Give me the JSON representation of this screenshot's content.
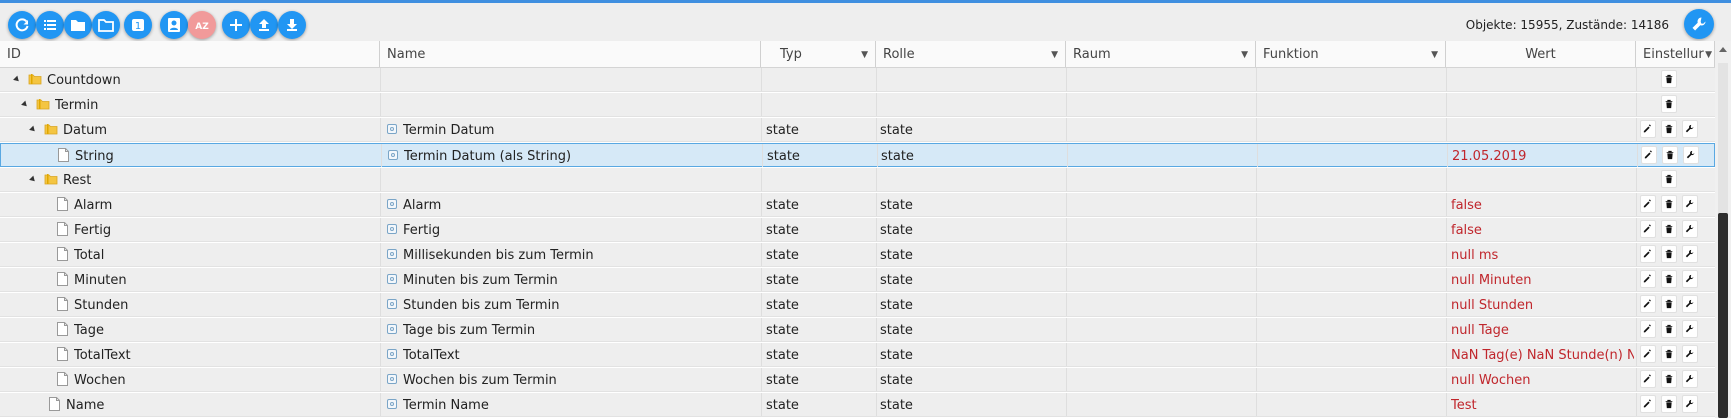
{
  "toolbar": {
    "buttons": [
      {
        "name": "refresh-button",
        "icon": "refresh-icon"
      },
      {
        "name": "list-view-button",
        "icon": "list-icon"
      },
      {
        "name": "expand-folders-button",
        "icon": "folder-icon"
      },
      {
        "name": "collapse-folders-button",
        "icon": "folder-open-icon"
      },
      {
        "name": "level-button",
        "icon": "number-one-icon",
        "label": "1"
      },
      {
        "name": "edit-roles-button",
        "icon": "contact-icon"
      },
      {
        "name": "sort-az-button",
        "icon": "sort-az-icon",
        "label": "AZ"
      },
      {
        "name": "add-button",
        "icon": "plus-icon"
      },
      {
        "name": "upload-button",
        "icon": "upload-icon"
      },
      {
        "name": "download-button",
        "icon": "download-icon"
      }
    ],
    "stats": "Objekte: 15955, Zustände: 14186",
    "settings_icon": "wrench-icon"
  },
  "columns": {
    "id": "ID",
    "name": "Name",
    "type": "Typ",
    "role": "Rolle",
    "room": "Raum",
    "function": "Funktion",
    "value": "Wert",
    "settings": "Einstellur"
  },
  "rows": [
    {
      "id": "Countdown",
      "level": 1,
      "kind": "folder",
      "name": "",
      "type": "",
      "role": "",
      "value": "",
      "actions": [
        "delete"
      ]
    },
    {
      "id": "Termin",
      "level": 2,
      "kind": "folder",
      "name": "",
      "type": "",
      "role": "",
      "value": "",
      "actions": [
        "delete"
      ]
    },
    {
      "id": "Datum",
      "level": 3,
      "kind": "folder",
      "name": "Termin Datum",
      "type": "state",
      "role": "state",
      "value": "",
      "actions": [
        "edit",
        "delete",
        "settings"
      ]
    },
    {
      "id": "String",
      "level": 4,
      "kind": "file",
      "name": "Termin Datum (als String)",
      "type": "state",
      "role": "state",
      "value": "21.05.2019",
      "selected": true,
      "actions": [
        "edit",
        "delete",
        "settings"
      ]
    },
    {
      "id": "Rest",
      "level": 3,
      "kind": "folder",
      "name": "",
      "type": "",
      "role": "",
      "value": "",
      "actions": [
        "delete"
      ]
    },
    {
      "id": "Alarm",
      "level": 4,
      "kind": "file",
      "name": "Alarm",
      "type": "state",
      "role": "state",
      "value": "false",
      "actions": [
        "edit",
        "delete",
        "settings"
      ]
    },
    {
      "id": "Fertig",
      "level": 4,
      "kind": "file",
      "name": "Fertig",
      "type": "state",
      "role": "state",
      "value": "false",
      "actions": [
        "edit",
        "delete",
        "settings"
      ]
    },
    {
      "id": "Total",
      "level": 4,
      "kind": "file",
      "name": "Millisekunden bis zum Termin",
      "type": "state",
      "role": "state",
      "value": "null ms",
      "actions": [
        "edit",
        "delete",
        "settings"
      ]
    },
    {
      "id": "Minuten",
      "level": 4,
      "kind": "file",
      "name": "Minuten bis zum Termin",
      "type": "state",
      "role": "state",
      "value": "null Minuten",
      "actions": [
        "edit",
        "delete",
        "settings"
      ]
    },
    {
      "id": "Stunden",
      "level": 4,
      "kind": "file",
      "name": "Stunden bis zum Termin",
      "type": "state",
      "role": "state",
      "value": "null Stunden",
      "actions": [
        "edit",
        "delete",
        "settings"
      ]
    },
    {
      "id": "Tage",
      "level": 4,
      "kind": "file",
      "name": "Tage bis zum Termin",
      "type": "state",
      "role": "state",
      "value": "null Tage",
      "actions": [
        "edit",
        "delete",
        "settings"
      ]
    },
    {
      "id": "TotalText",
      "level": 4,
      "kind": "file",
      "name": "TotalText",
      "type": "state",
      "role": "state",
      "value": "NaN Tag(e) NaN Stunde(n) NaN",
      "actions": [
        "edit",
        "delete",
        "settings"
      ]
    },
    {
      "id": "Wochen",
      "level": 4,
      "kind": "file",
      "name": "Wochen bis zum Termin",
      "type": "state",
      "role": "state",
      "value": "null Wochen",
      "actions": [
        "edit",
        "delete",
        "settings"
      ]
    },
    {
      "id": "Name",
      "level": 3,
      "kind": "file",
      "name": "Termin Name",
      "type": "state",
      "role": "state",
      "value": "Test",
      "actions": [
        "edit",
        "delete",
        "settings"
      ]
    }
  ],
  "colors": {
    "accent": "#2196f3",
    "value_text": "#c0262c",
    "selected_row": "#d6e9f7"
  }
}
